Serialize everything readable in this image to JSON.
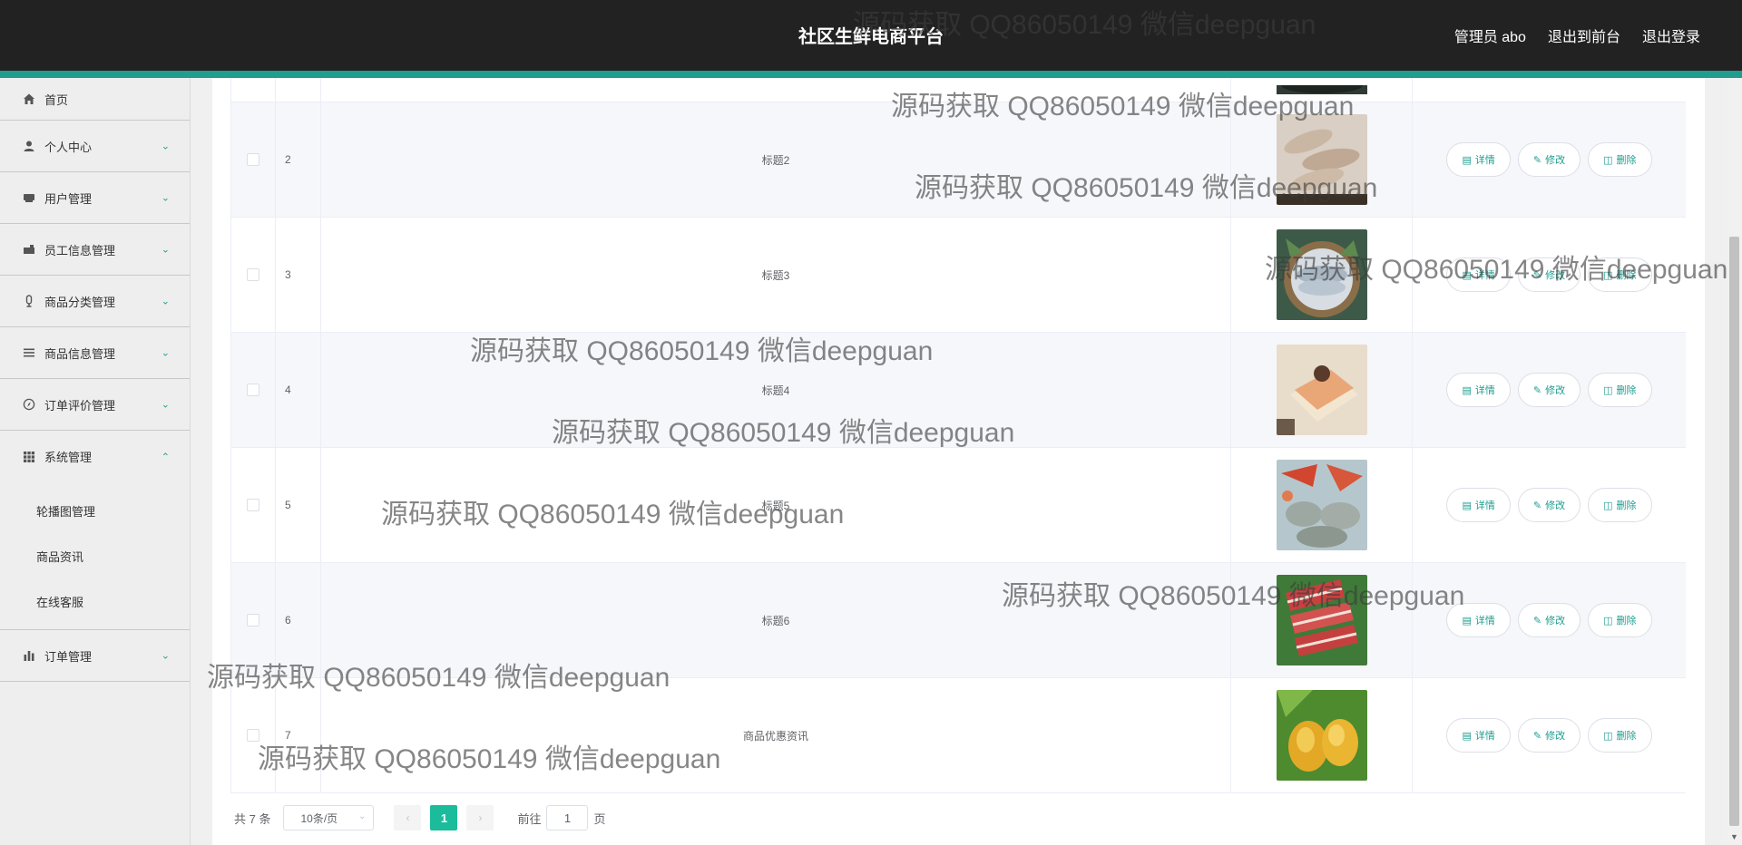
{
  "header": {
    "title": "社区生鲜电商平台",
    "user": "管理员 abo",
    "to_front": "退出到前台",
    "logout": "退出登录"
  },
  "sidebar": {
    "items": [
      {
        "label": "首页",
        "icon": "home-icon"
      },
      {
        "label": "个人中心",
        "icon": "user-icon"
      },
      {
        "label": "用户管理",
        "icon": "users-icon"
      },
      {
        "label": "员工信息管理",
        "icon": "briefcase-icon"
      },
      {
        "label": "商品分类管理",
        "icon": "mic-icon"
      },
      {
        "label": "商品信息管理",
        "icon": "list-icon"
      },
      {
        "label": "订单评价管理",
        "icon": "compass-icon"
      },
      {
        "label": "系统管理",
        "icon": "grid-icon"
      },
      {
        "label": "订单管理",
        "icon": "bar-chart-icon"
      }
    ],
    "system_sub": [
      "轮播图管理",
      "商品资讯",
      "在线客服"
    ]
  },
  "table": {
    "rows": [
      {
        "index": "2",
        "title": "标题2",
        "image": "shrimp-image"
      },
      {
        "index": "3",
        "title": "标题3",
        "image": "fish-image"
      },
      {
        "index": "4",
        "title": "标题4",
        "image": "cake-image"
      },
      {
        "index": "5",
        "title": "标题5",
        "image": "seafood-image"
      },
      {
        "index": "6",
        "title": "标题6",
        "image": "meat-image"
      },
      {
        "index": "7",
        "title": "商品优惠资讯",
        "image": "mango-image"
      }
    ],
    "actions": {
      "detail": "详情",
      "edit": "修改",
      "delete": "删除"
    }
  },
  "pagination": {
    "total": "共 7 条",
    "page_size": "10条/页",
    "current_page": "1",
    "goto_label": "前往",
    "goto_value": "1",
    "page_unit": "页"
  },
  "watermark": "源码获取 QQ86050149 微信deepguan",
  "colors": {
    "header_bg": "#222222",
    "accent": "#1f9d8f",
    "active_page": "#1abc9c"
  }
}
